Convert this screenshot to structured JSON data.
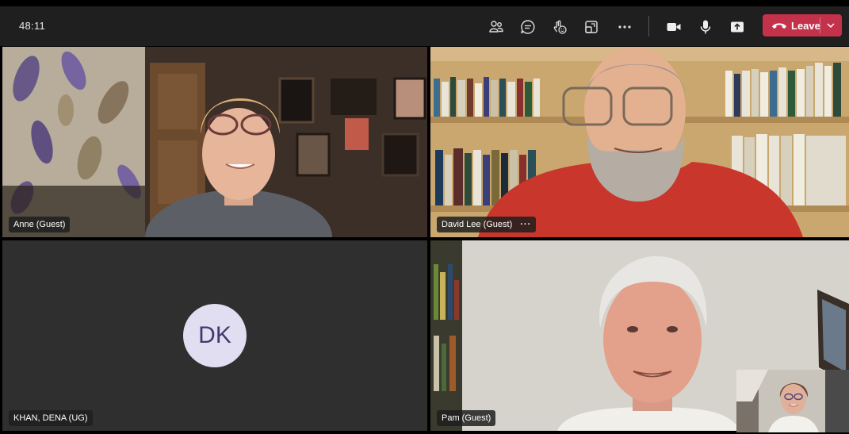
{
  "toolbar": {
    "timer": "48:11",
    "leave_label": "Leave",
    "icons": [
      "people-icon",
      "chat-icon",
      "reactions-icon",
      "rooms-icon",
      "more-icon",
      "camera-icon",
      "mic-icon",
      "share-icon"
    ]
  },
  "tiles": [
    {
      "name": "Anne (Guest)"
    },
    {
      "name": "David Lee (Guest)",
      "more": "···"
    },
    {
      "name": "KHAN, DENA (UG)",
      "initials": "DK"
    },
    {
      "name": "Pam (Guest)"
    }
  ],
  "colors": {
    "leave": "#c4314b",
    "toolbar": "#1f1f1f",
    "avatar_bg": "#e1def2",
    "avatar_text": "#403b6b"
  }
}
